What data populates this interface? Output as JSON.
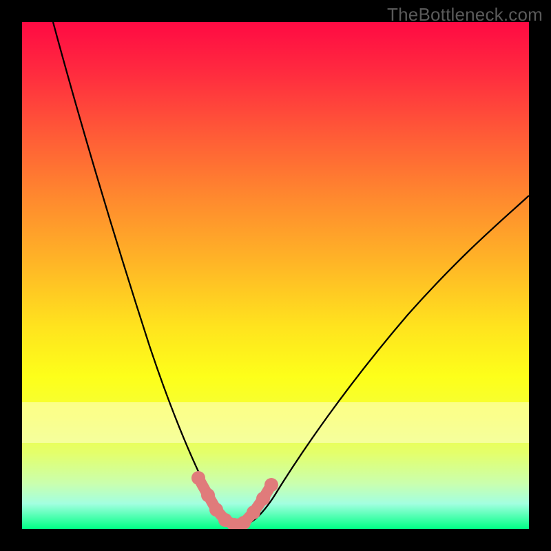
{
  "watermark": "TheBottleneck.com",
  "chart_data": {
    "type": "line",
    "title": "",
    "xlabel": "",
    "ylabel": "",
    "xlim": [
      0,
      100
    ],
    "ylim": [
      0,
      100
    ],
    "background_gradient": {
      "top_color": "#ff0a43",
      "mid_color": "#ffe31e",
      "bottom_color": "#00ff85"
    },
    "series": [
      {
        "name": "left-curve",
        "x": [
          6,
          10,
          14,
          18,
          22,
          26,
          30,
          33,
          35,
          36.5,
          38,
          39.5,
          41,
          42
        ],
        "values": [
          100,
          86,
          72,
          58,
          44,
          31,
          20,
          12,
          8,
          5,
          3,
          1.5,
          0.7,
          0.3
        ]
      },
      {
        "name": "right-curve",
        "x": [
          42,
          44,
          46,
          49,
          53,
          58,
          64,
          72,
          82,
          92,
          100
        ],
        "values": [
          0.3,
          1.2,
          3,
          6,
          11,
          18,
          26,
          36,
          48,
          58,
          66
        ]
      }
    ],
    "highlight": {
      "name": "optimal-zone",
      "x": [
        35,
        36.5,
        38,
        39.5,
        41,
        42,
        44,
        46,
        49
      ],
      "values": [
        8,
        5,
        3,
        1.5,
        0.7,
        0.3,
        1.2,
        3,
        6
      ],
      "color": "#e07b7b"
    }
  }
}
